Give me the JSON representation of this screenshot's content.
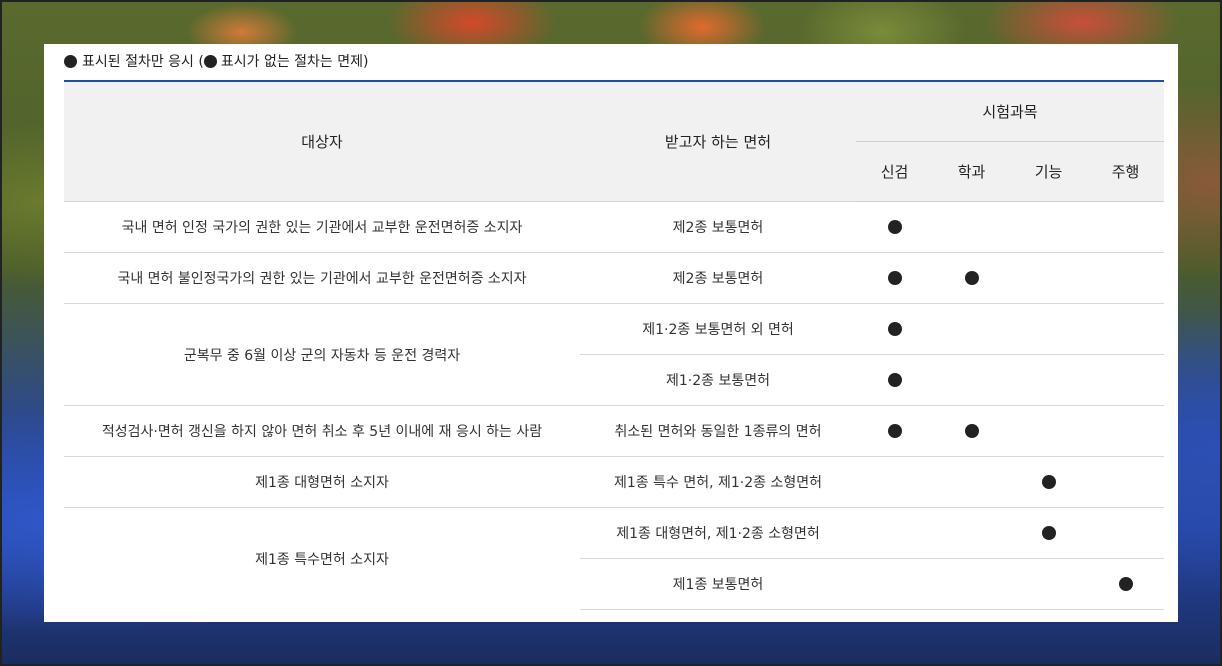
{
  "note": {
    "part1": "표시된 절차만 응시 (",
    "part2": "표시가 없는 절차는 면제)"
  },
  "header": {
    "target": "대상자",
    "license": "받고자 하는 면허",
    "subjects": "시험과목",
    "col_check": "신검",
    "col_theory": "학과",
    "col_skill": "기능",
    "col_road": "주행"
  },
  "rows": [
    {
      "target": "국내 면허 인정 국가의 권한 있는 기관에서 교부한 운전면허증 소지자",
      "licenses": [
        {
          "name": "제2종 보통면허",
          "check": true,
          "theory": false,
          "skill": false,
          "road": false
        }
      ]
    },
    {
      "target": "국내 면허 불인정국가의 권한 있는 기관에서 교부한 운전면허증 소지자",
      "licenses": [
        {
          "name": "제2종 보통면허",
          "check": true,
          "theory": true,
          "skill": false,
          "road": false
        }
      ]
    },
    {
      "target": "군복무 중 6월 이상 군의 자동차 등 운전 경력자",
      "licenses": [
        {
          "name": "제1·2종 보통면허 외 면허",
          "check": true,
          "theory": false,
          "skill": false,
          "road": false
        },
        {
          "name": "제1·2종 보통면허",
          "check": true,
          "theory": false,
          "skill": false,
          "road": false
        }
      ]
    },
    {
      "target": "적성검사·면허 갱신을 하지 않아 면허 취소 후 5년 이내에 재 응시 하는 사람",
      "licenses": [
        {
          "name": "취소된 면허와 동일한 1종류의 면허",
          "check": true,
          "theory": true,
          "skill": false,
          "road": false
        }
      ]
    },
    {
      "target": "제1종 대형면허 소지자",
      "licenses": [
        {
          "name": "제1종 특수 면허, 제1·2종 소형면허",
          "check": false,
          "theory": false,
          "skill": true,
          "road": false
        }
      ]
    },
    {
      "target": "제1종 특수면허 소지자",
      "licenses": [
        {
          "name": "제1종 대형면허, 제1·2종 소형면허",
          "check": false,
          "theory": false,
          "skill": true,
          "road": false
        },
        {
          "name": "제1종 보통면허",
          "check": false,
          "theory": false,
          "skill": false,
          "road": true
        }
      ]
    }
  ]
}
